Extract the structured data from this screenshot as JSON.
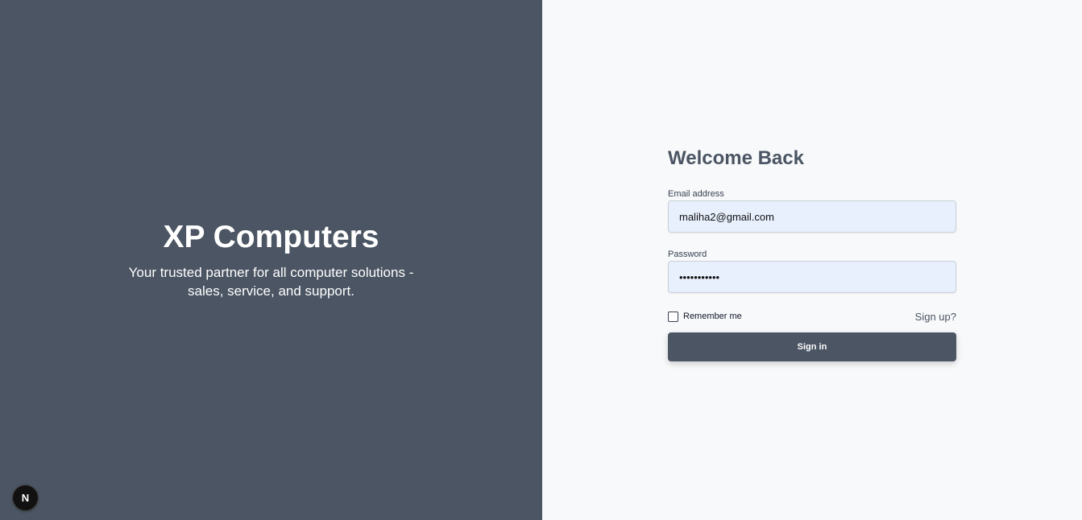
{
  "brand": {
    "title": "XP Computers",
    "tagline": "Your trusted partner for all computer solutions - sales, service, and support.",
    "badge_letter": "N",
    "background_color": "#4b5563"
  },
  "form": {
    "heading": "Welcome Back",
    "email": {
      "label": "Email address",
      "value": "maliha2@gmail.com"
    },
    "password": {
      "label": "Password",
      "value": "•••••••••••"
    },
    "remember_label": "Remember me",
    "remember_checked": false,
    "signup_label": "Sign up?",
    "submit_label": "Sign in",
    "accent_color": "#4b5563",
    "input_background": "#e8f0fe"
  }
}
